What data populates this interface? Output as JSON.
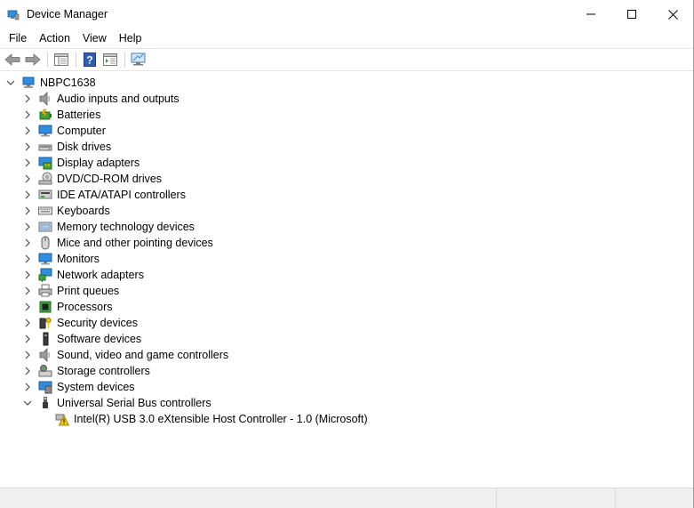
{
  "window": {
    "title": "Device Manager"
  },
  "menu": {
    "items": [
      {
        "id": "file",
        "label": "File"
      },
      {
        "id": "action",
        "label": "Action"
      },
      {
        "id": "view",
        "label": "View"
      },
      {
        "id": "help",
        "label": "Help"
      }
    ]
  },
  "toolbar": {
    "buttons": [
      {
        "name": "back-button",
        "icon": "arrow-left-icon"
      },
      {
        "name": "forward-button",
        "icon": "arrow-right-icon"
      },
      {
        "name": "show-hide-console-tree-button",
        "icon": "console-tree-icon"
      },
      {
        "name": "help-button",
        "icon": "help-icon"
      },
      {
        "name": "properties-button",
        "icon": "properties-icon"
      },
      {
        "name": "scan-hardware-button",
        "icon": "monitor-scan-icon"
      }
    ]
  },
  "tree": {
    "root": {
      "label": "NBPC1638",
      "icon": "computer-network-icon",
      "expanded": true
    },
    "categories": [
      {
        "label": "Audio inputs and outputs",
        "icon": "speaker-icon"
      },
      {
        "label": "Batteries",
        "icon": "battery-icon"
      },
      {
        "label": "Computer",
        "icon": "computer-icon"
      },
      {
        "label": "Disk drives",
        "icon": "disk-drive-icon"
      },
      {
        "label": "Display adapters",
        "icon": "display-adapter-icon"
      },
      {
        "label": "DVD/CD-ROM drives",
        "icon": "dvd-drive-icon"
      },
      {
        "label": "IDE ATA/ATAPI controllers",
        "icon": "ide-controller-icon"
      },
      {
        "label": "Keyboards",
        "icon": "keyboard-icon"
      },
      {
        "label": "Memory technology devices",
        "icon": "memory-icon"
      },
      {
        "label": "Mice and other pointing devices",
        "icon": "mouse-icon"
      },
      {
        "label": "Monitors",
        "icon": "monitor-icon"
      },
      {
        "label": "Network adapters",
        "icon": "network-adapter-icon"
      },
      {
        "label": "Print queues",
        "icon": "printer-icon"
      },
      {
        "label": "Processors",
        "icon": "processor-icon"
      },
      {
        "label": "Security devices",
        "icon": "security-key-icon"
      },
      {
        "label": "Software devices",
        "icon": "software-device-icon"
      },
      {
        "label": "Sound, video and game controllers",
        "icon": "speaker-icon"
      },
      {
        "label": "Storage controllers",
        "icon": "storage-controller-icon"
      },
      {
        "label": "System devices",
        "icon": "system-device-icon"
      },
      {
        "label": "Universal Serial Bus controllers",
        "icon": "usb-icon",
        "expanded": true
      }
    ],
    "children": [
      {
        "label": "Intel(R) USB 3.0 eXtensible Host Controller - 1.0 (Microsoft)",
        "icon": "warning-icon",
        "status": "warning"
      }
    ]
  },
  "colors": {
    "warning": "#f5c400",
    "monitor_blue": "#2f8ee0",
    "help_blue": "#2d5fb5"
  }
}
